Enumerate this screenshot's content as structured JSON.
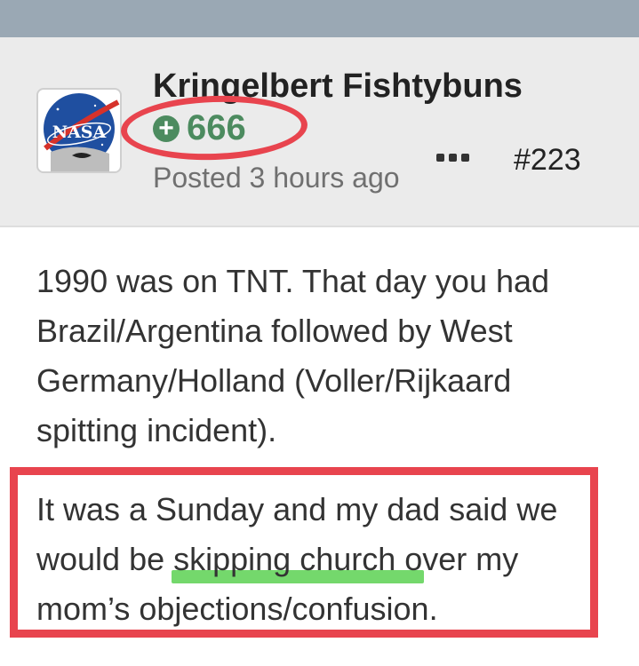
{
  "post": {
    "author": "Kringelbert Fishtybuns",
    "reputation": "666",
    "posted": "Posted 3 hours ago",
    "number": "#223",
    "avatar_text": "NASA",
    "paragraphs": [
      "1990 was on TNT.  That day you had Brazil/Argentina followed by West Germany/Holland (Voller/Rijkaard spitting incident).",
      "It was a Sunday and my dad said we would be skipping church over my mom’s objections/confusion."
    ],
    "para2_lines": {
      "line1": "It was a Sunday and my dad said we",
      "line2": "would be skipping church over my",
      "line3": "mom’s objections/confusion."
    }
  },
  "icons": {
    "reputation": "plus-circle-icon",
    "more": "ellipsis-icon",
    "avatar": "nasa-logo-icon"
  },
  "colors": {
    "header_bg": "#ebebeb",
    "top_bar": "#9aa8b4",
    "reputation_green": "#4c8b5f",
    "annotation_red": "#e8444e",
    "annotation_green": "#74d86c"
  }
}
